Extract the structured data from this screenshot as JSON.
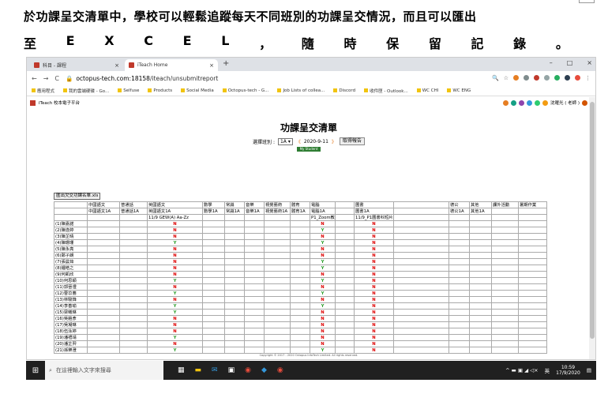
{
  "caption": {
    "line1": "於功課呈交清單中，學校可以輕鬆追蹤每天不同班別的功課呈交情況，而且可以匯出",
    "line2": [
      "至",
      "E",
      "X",
      "C",
      "E",
      "L",
      "，",
      "隨",
      "時",
      "保",
      "留",
      "記",
      "錄",
      "。"
    ]
  },
  "browser": {
    "tabs": [
      {
        "title": "科目 - 課程",
        "close": "×"
      },
      {
        "title": "iTeach Home",
        "close": "×"
      }
    ],
    "new_tab": "+",
    "window_controls": [
      "–",
      "□",
      "×"
    ],
    "nav": {
      "back": "←",
      "forward": "→",
      "reload": "C"
    },
    "url_host": "octopus-tech.com:18158",
    "url_path": "/iteach/unsubmitreport",
    "bookmarks": [
      "應用程式",
      "我的雲端硬碟 - Go...",
      "Selfuse",
      "Products",
      "Social Media",
      "Octopus-tech - G...",
      "Job Lists of collea...",
      "Discord",
      "收件匣 - Outlook...",
      "WC CHI",
      "WC ENG"
    ]
  },
  "site": {
    "name": "iTeach 校本電子平台",
    "user": "沈曜光 ( 老師 )"
  },
  "report": {
    "title": "功課呈交清單",
    "class_label": "選擇班別 :",
    "class_value": "1A",
    "date_prev": "《",
    "date": "2020-9-11",
    "date_next": "》",
    "fetch_button": "取得報告",
    "green_button": "My Student",
    "export_button": "匯出欠交功課名單.xls",
    "header_subjects": [
      "中國語文",
      "普通話",
      "英國語文",
      "數學",
      "常識",
      "音樂",
      "視覺藝術",
      "體育",
      "電腦",
      "",
      "圖書",
      "",
      "德公",
      "其他",
      "課外活動",
      "暑期作業"
    ],
    "header_groups": [
      "中國語文1A",
      "普通話1A",
      "英國語文1A",
      "數學1A",
      "常識1A",
      "音樂1A",
      "視覺藝術1A",
      "體育1A",
      "電腦1A",
      "",
      "圖書1A",
      "",
      "德公1A",
      "其他1A",
      "",
      ""
    ],
    "header_tasks": [
      "",
      "",
      "11/9 GEW(A) Aa-Zz",
      "",
      "",
      "",
      "",
      "",
      "P1_Zoom教學",
      "",
      "11/9_P1圖書科短片教學_電子書",
      "",
      "",
      "",
      "",
      ""
    ],
    "students": [
      {
        "name": "(1)陳嘉諾",
        "eng": "N",
        "comp": "N",
        "lib": "N"
      },
      {
        "name": "(2)陳逸婷",
        "eng": "N",
        "comp": "Y",
        "lib": "N"
      },
      {
        "name": "(3)陳芷晴",
        "eng": "N",
        "comp": "N",
        "lib": "N"
      },
      {
        "name": "(4)陳珊珊",
        "eng": "Y",
        "comp": "Y",
        "lib": "N"
      },
      {
        "name": "(5)陳永亮",
        "eng": "N",
        "comp": "N",
        "lib": "N"
      },
      {
        "name": "(6)鄭子朗",
        "eng": "N",
        "comp": "N",
        "lib": "N"
      },
      {
        "name": "(7)張晨茹",
        "eng": "N",
        "comp": "Y",
        "lib": "N"
      },
      {
        "name": "(8)鍾皓之",
        "eng": "N",
        "comp": "Y",
        "lib": "N"
      },
      {
        "name": "(9)何凱欣",
        "eng": "N",
        "comp": "N",
        "lib": "N"
      },
      {
        "name": "(10)何思穎",
        "eng": "Y",
        "comp": "Y",
        "lib": "N"
      },
      {
        "name": "(11)郭晉澧",
        "eng": "N",
        "comp": "N",
        "lib": "N"
      },
      {
        "name": "(12)曹苡蕎",
        "eng": "Y",
        "comp": "Y",
        "lib": "N"
      },
      {
        "name": "(13)林駿鋒",
        "eng": "N",
        "comp": "N",
        "lib": "N"
      },
      {
        "name": "(14)李善瑜",
        "eng": "Y",
        "comp": "Y",
        "lib": "N"
      },
      {
        "name": "(15)梁曦琳",
        "eng": "Y",
        "comp": "N",
        "lib": "N"
      },
      {
        "name": "(16)吳鎧彥",
        "eng": "N",
        "comp": "N",
        "lib": "N"
      },
      {
        "name": "(17)吳凝琳",
        "eng": "N",
        "comp": "N",
        "lib": "N"
      },
      {
        "name": "(18)伍泳婷",
        "eng": "N",
        "comp": "N",
        "lib": "N"
      },
      {
        "name": "(19)潘禮靖",
        "eng": "Y",
        "comp": "N",
        "lib": "N"
      },
      {
        "name": "(20)潘芷羿",
        "eng": "N",
        "comp": "N",
        "lib": "N"
      },
      {
        "name": "(21)孫樂澄",
        "eng": "Y",
        "comp": "Y",
        "lib": "N"
      }
    ],
    "copyright": "Copyright © 2017 - 2020 Octopus InfoTech Limited. All rights reserved."
  },
  "taskbar": {
    "search_placeholder": "在這裡輸入文字來搜尋",
    "time": "10:59",
    "date": "17/9/2020",
    "lang": "英"
  },
  "colors": {
    "no": "#dd0000",
    "yes": "#2a9d2a",
    "taskbar": "#202020"
  }
}
